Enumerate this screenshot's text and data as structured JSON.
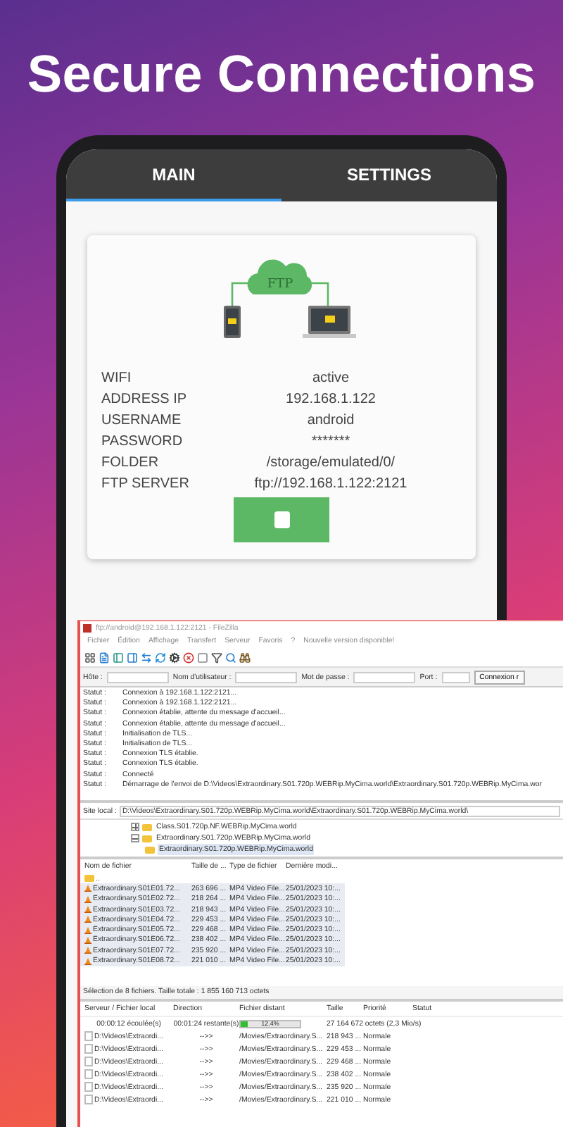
{
  "headline": "Secure Connections",
  "app": {
    "tabs": [
      {
        "label": "MAIN",
        "selected": true
      },
      {
        "label": "SETTINGS",
        "selected": false
      }
    ],
    "cloud_label": "FTP",
    "info": [
      {
        "label": "WIFI",
        "value": "active"
      },
      {
        "label": "ADDRESS IP",
        "value": "192.168.1.122"
      },
      {
        "label": "USERNAME",
        "value": "android"
      },
      {
        "label": "PASSWORD",
        "value": "*******"
      },
      {
        "label": "FOLDER",
        "value": "/storage/emulated/0/"
      },
      {
        "label": "FTP SERVER",
        "value": "ftp://192.168.1.122:2121"
      }
    ]
  },
  "filezilla": {
    "title": "ftp://android@192.168.1.122:2121 - FileZilla",
    "menu": [
      "Fichier",
      "Édition",
      "Affichage",
      "Transfert",
      "Serveur",
      "Favoris",
      "?",
      "Nouvelle version disponible!"
    ],
    "quickconnect": {
      "fields": [
        "Hôte :",
        "Nom d'utilisateur :",
        "Mot de passe :",
        "Port :"
      ],
      "button": "Connexion r"
    },
    "log": [
      {
        "label": "Statut :",
        "message": "Connexion à 192.168.1.122:2121..."
      },
      {
        "label": "Statut :",
        "message": "Connexion à 192.168.1.122:2121..."
      },
      {
        "label": "Statut :",
        "message": "Connexion établie, attente du message d'accueil..."
      },
      {
        "label": "Statut :",
        "message": "Connexion établie, attente du message d'accueil..."
      },
      {
        "label": "Statut :",
        "message": "Initialisation de TLS..."
      },
      {
        "label": "Statut :",
        "message": "Initialisation de TLS..."
      },
      {
        "label": "Statut :",
        "message": "Connexion TLS établie."
      },
      {
        "label": "Statut :",
        "message": "Connexion TLS établie."
      },
      {
        "label": "Statut :",
        "message": "Connecté"
      },
      {
        "label": "Statut :",
        "message": "Démarrage de l'envoi de D:\\Videos\\Extraordinary.S01.720p.WEBRip.MyCima.world\\Extraordinary.S01.720p.WEBRip.MyCima.wor"
      }
    ],
    "local_site": {
      "label": "Site local :",
      "path": "D:\\Videos\\Extraordinary.S01.720p.WEBRip.MyCima.world\\Extraordinary.S01.720p.WEBRip.MyCima.world\\"
    },
    "tree": [
      {
        "name": "Class.S01.720p.NF.WEBRip.MyCima.world",
        "expanded": false,
        "selected": false
      },
      {
        "name": "Extraordinary.S01.720p.WEBRip.MyCima.world",
        "expanded": true,
        "selected": false,
        "children": [
          {
            "name": "Extraordinary.S01.720p.WEBRip.MyCima.world",
            "selected": true
          }
        ]
      }
    ],
    "files": {
      "columns": [
        "Nom de fichier",
        "Taille de ...",
        "Type de fichier",
        "Dernière modi..."
      ],
      "rows": [
        {
          "kind": "folder",
          "name": "..",
          "selected": false
        },
        {
          "kind": "video",
          "name": "Extraordinary.S01E01.72...",
          "size": "263 696 ...",
          "type": "MP4 Video File...",
          "modified": "25/01/2023 10:...",
          "selected": true
        },
        {
          "kind": "video",
          "name": "Extraordinary.S01E02.72...",
          "size": "218 264 ...",
          "type": "MP4 Video File...",
          "modified": "25/01/2023 10:...",
          "selected": true
        },
        {
          "kind": "video",
          "name": "Extraordinary.S01E03.72...",
          "size": "218 943 ...",
          "type": "MP4 Video File...",
          "modified": "25/01/2023 10:...",
          "selected": true
        },
        {
          "kind": "video",
          "name": "Extraordinary.S01E04.72...",
          "size": "229 453 ...",
          "type": "MP4 Video File...",
          "modified": "25/01/2023 10:...",
          "selected": true
        },
        {
          "kind": "video",
          "name": "Extraordinary.S01E05.72...",
          "size": "229 468 ...",
          "type": "MP4 Video File...",
          "modified": "25/01/2023 10:...",
          "selected": true
        },
        {
          "kind": "video",
          "name": "Extraordinary.S01E06.72...",
          "size": "238 402 ...",
          "type": "MP4 Video File...",
          "modified": "25/01/2023 10:...",
          "selected": true
        },
        {
          "kind": "video",
          "name": "Extraordinary.S01E07.72...",
          "size": "235 920 ...",
          "type": "MP4 Video File...",
          "modified": "25/01/2023 10:...",
          "selected": true
        },
        {
          "kind": "video",
          "name": "Extraordinary.S01E08.72...",
          "size": "221 010 ...",
          "type": "MP4 Video File...",
          "modified": "25/01/2023 10:...",
          "selected": true
        }
      ]
    },
    "selection_status": "Sélection de 8 fichiers. Taille totale : 1 855 160 713 octets",
    "queue": {
      "columns": [
        "Serveur / Fichier local",
        "Direction",
        "Fichier distant",
        "Taille",
        "Priorité",
        "Statut"
      ],
      "progress": {
        "elapsed": "00:00:12 écoulée(s)",
        "remaining": "00:01:24 restante(s)",
        "percent": "12.4%",
        "level": 0.124,
        "transferred": "27 164 672 octets (2,3 Mio/s)"
      },
      "rows": [
        {
          "local": "D:\\Videos\\Extraordi...",
          "direction": "-->>",
          "remote": "/Movies/Extraordinary.S...",
          "size": "218 943 ...",
          "priority": "Normale"
        },
        {
          "local": "D:\\Videos\\Extraordi...",
          "direction": "-->>",
          "remote": "/Movies/Extraordinary.S...",
          "size": "229 453 ...",
          "priority": "Normale"
        },
        {
          "local": "D:\\Videos\\Extraordi...",
          "direction": "-->>",
          "remote": "/Movies/Extraordinary.S...",
          "size": "229 468 ...",
          "priority": "Normale"
        },
        {
          "local": "D:\\Videos\\Extraordi...",
          "direction": "-->>",
          "remote": "/Movies/Extraordinary.S...",
          "size": "238 402 ...",
          "priority": "Normale"
        },
        {
          "local": "D:\\Videos\\Extraordi...",
          "direction": "-->>",
          "remote": "/Movies/Extraordinary.S...",
          "size": "235 920 ...",
          "priority": "Normale"
        },
        {
          "local": "D:\\Videos\\Extraordi...",
          "direction": "-->>",
          "remote": "/Movies/Extraordinary.S...",
          "size": "221 010 ...",
          "priority": "Normale"
        }
      ]
    }
  }
}
